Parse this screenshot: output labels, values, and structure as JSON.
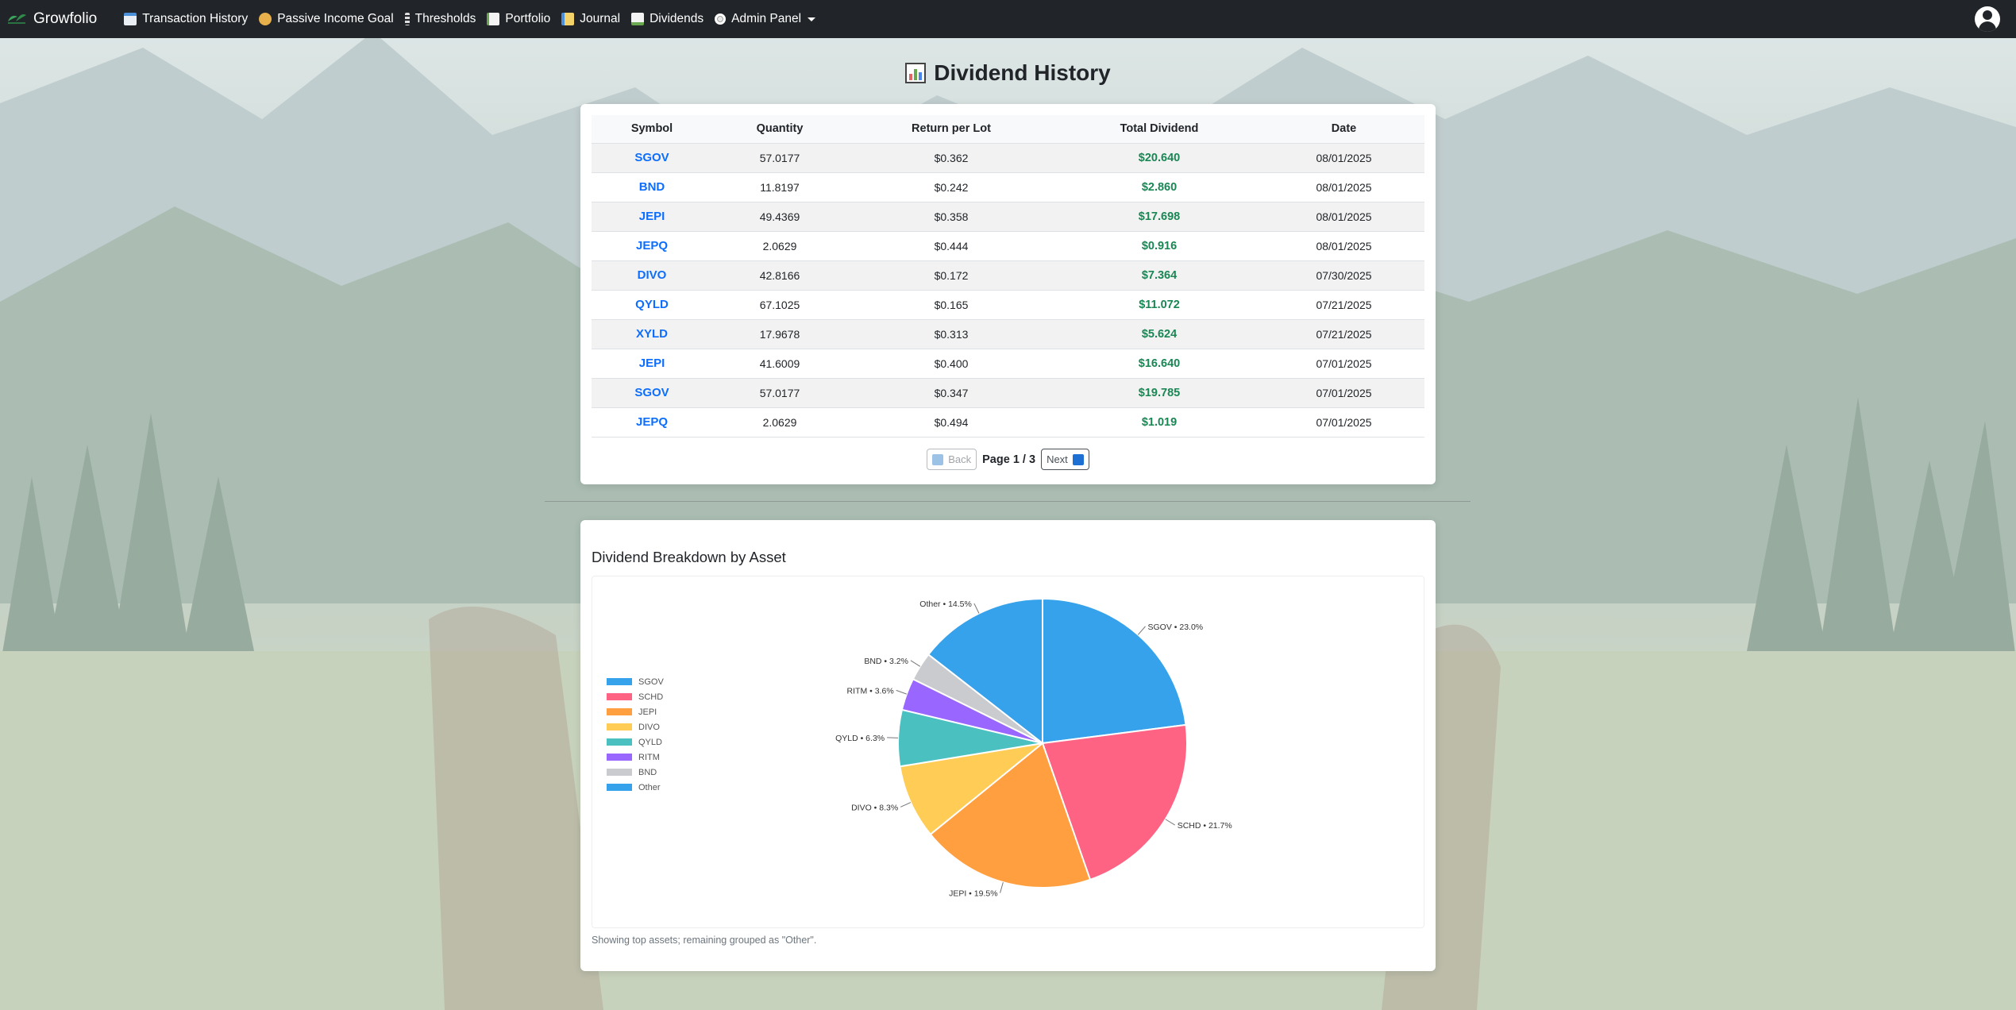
{
  "navbar": {
    "brand": "Growfolio",
    "items": [
      {
        "label": "Transaction History",
        "icon": "calendar-icon"
      },
      {
        "label": "Passive Income Goal",
        "icon": "coins-icon"
      },
      {
        "label": "Thresholds",
        "icon": "thresholds-icon"
      },
      {
        "label": "Portfolio",
        "icon": "chart-icon"
      },
      {
        "label": "Journal",
        "icon": "journal-icon"
      },
      {
        "label": "Dividends",
        "icon": "dividends-icon"
      },
      {
        "label": "Admin Panel",
        "icon": "gear-icon"
      }
    ]
  },
  "page": {
    "title": "Dividend History"
  },
  "table": {
    "headers": [
      "Symbol",
      "Quantity",
      "Return per Lot",
      "Total Dividend",
      "Date"
    ],
    "rows": [
      {
        "symbol": "SGOV",
        "quantity": "57.0177",
        "return_per_lot": "$0.362",
        "total": "$20.640",
        "date": "08/01/2025"
      },
      {
        "symbol": "BND",
        "quantity": "11.8197",
        "return_per_lot": "$0.242",
        "total": "$2.860",
        "date": "08/01/2025"
      },
      {
        "symbol": "JEPI",
        "quantity": "49.4369",
        "return_per_lot": "$0.358",
        "total": "$17.698",
        "date": "08/01/2025"
      },
      {
        "symbol": "JEPQ",
        "quantity": "2.0629",
        "return_per_lot": "$0.444",
        "total": "$0.916",
        "date": "08/01/2025"
      },
      {
        "symbol": "DIVO",
        "quantity": "42.8166",
        "return_per_lot": "$0.172",
        "total": "$7.364",
        "date": "07/30/2025"
      },
      {
        "symbol": "QYLD",
        "quantity": "67.1025",
        "return_per_lot": "$0.165",
        "total": "$11.072",
        "date": "07/21/2025"
      },
      {
        "symbol": "XYLD",
        "quantity": "17.9678",
        "return_per_lot": "$0.313",
        "total": "$5.624",
        "date": "07/21/2025"
      },
      {
        "symbol": "JEPI",
        "quantity": "41.6009",
        "return_per_lot": "$0.400",
        "total": "$16.640",
        "date": "07/01/2025"
      },
      {
        "symbol": "SGOV",
        "quantity": "57.0177",
        "return_per_lot": "$0.347",
        "total": "$19.785",
        "date": "07/01/2025"
      },
      {
        "symbol": "JEPQ",
        "quantity": "2.0629",
        "return_per_lot": "$0.494",
        "total": "$1.019",
        "date": "07/01/2025"
      }
    ]
  },
  "pagination": {
    "back_label": "Back",
    "next_label": "Next",
    "page_prefix": "Page",
    "current": "1",
    "separator": "/",
    "total": "3"
  },
  "chart_section": {
    "title": "Dividend Breakdown by Asset",
    "note": "Showing top assets; remaining grouped as \"Other\"."
  },
  "chart_data": {
    "type": "pie",
    "title": "Dividend Breakdown by Asset",
    "legend_position": "left",
    "slices": [
      {
        "name": "SGOV",
        "percent": 23.0,
        "label": "SGOV • 23.0%",
        "color": "#36a2eb"
      },
      {
        "name": "SCHD",
        "percent": 21.7,
        "label": "SCHD • 21.7%",
        "color": "#ff6384"
      },
      {
        "name": "JEPI",
        "percent": 19.5,
        "label": "JEPI • 19.5%",
        "color": "#ff9f40"
      },
      {
        "name": "DIVO",
        "percent": 8.3,
        "label": "DIVO • 8.3%",
        "color": "#ffcd56"
      },
      {
        "name": "QYLD",
        "percent": 6.3,
        "label": "QYLD • 6.3%",
        "color": "#4bc0c0"
      },
      {
        "name": "RITM",
        "percent": 3.6,
        "label": "RITM • 3.6%",
        "color": "#9966ff"
      },
      {
        "name": "BND",
        "percent": 3.2,
        "label": "BND • 3.2%",
        "color": "#c9cbcf"
      },
      {
        "name": "Other",
        "percent": 14.5,
        "label": "Other • 14.5%",
        "color": "#36a2eb"
      }
    ]
  }
}
